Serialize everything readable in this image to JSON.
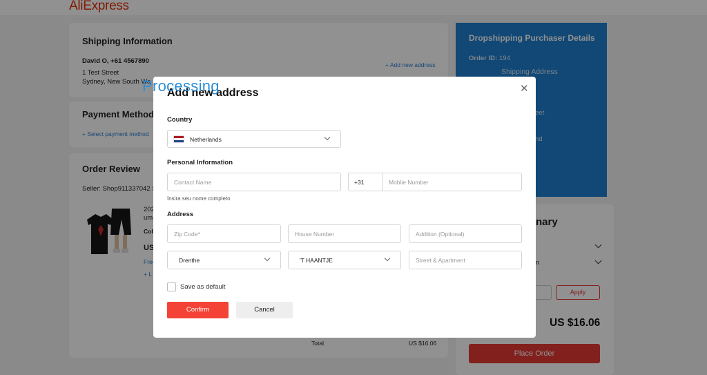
{
  "header": {
    "logo": "AliExpress"
  },
  "shipping": {
    "title": "Shipping Information",
    "name_phone": "David O, +61 4567890",
    "street": "1 Test Street",
    "city": "Sydney, New South Wa",
    "add_link": "+ Add new address"
  },
  "payment": {
    "title": "Payment Methods",
    "select_link": "+ Select payment method"
  },
  "order_review": {
    "title": "Order Review",
    "seller": "Seller: Shop911337042 S",
    "item_text_1": "202",
    "item_text_2": "um",
    "item_color": "Colo",
    "item_price": "US",
    "item_free": "Free",
    "item_add": "+ L",
    "total_label": "Total",
    "total_value": "US $16.06"
  },
  "dropship": {
    "title": "Dropshipping Purchaser Details",
    "order_id_label": "Order ID:",
    "order_id": "194",
    "shipping_address": "Shipping Address",
    "frag_1": "eet",
    "frag_2": "nd"
  },
  "summary": {
    "title": "nary",
    "frag": "n",
    "apply": "Apply",
    "total": "US $16.06",
    "place_order": "Place Order"
  },
  "modal": {
    "processing": "Processing",
    "title": "Add new address",
    "country_label": "Country",
    "country_value": "Netherlands",
    "personal_label": "Personal Information",
    "contact_placeholder": "Contact Name",
    "phone_code": "+31",
    "mobile_placeholder": "Moblie Number",
    "helper": "Insira seu nome completo",
    "address_label": "Address",
    "zip_placeholder": "Zip Code*",
    "house_placeholder": "House Number",
    "addition_placeholder": "Addition (Optional)",
    "province_value": "Drenthe",
    "city_value": "'T HAANTJE",
    "street_placeholder": "Street & Apartment",
    "save_default": "Save as default",
    "confirm": "Confirm",
    "cancel": "Cancel",
    "close": "✕"
  },
  "colors": {
    "accent_red": "#f44336",
    "link_blue": "#2d7fd3",
    "panel_blue": "#1f7fcf"
  }
}
